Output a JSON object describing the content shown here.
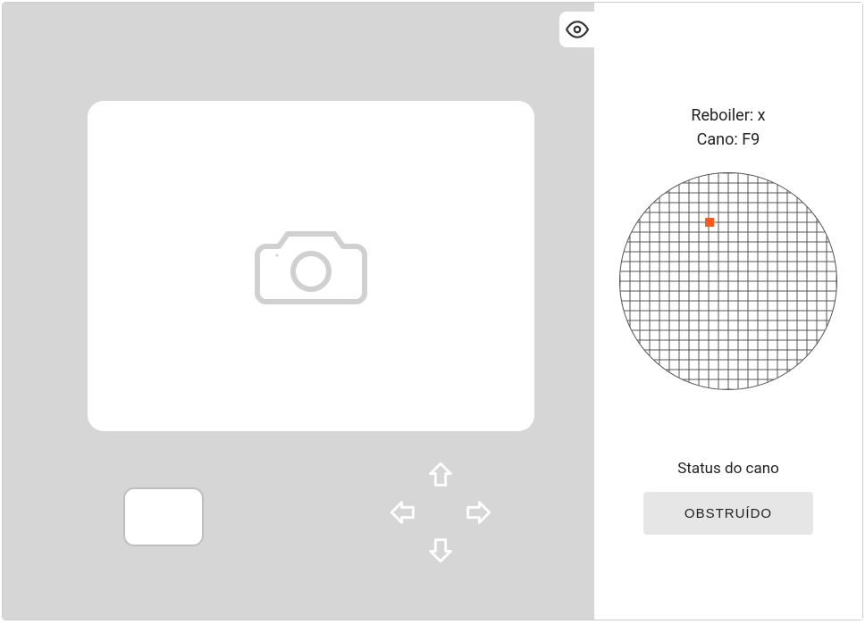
{
  "panel": {
    "reboiler_label": "Reboiler: ",
    "reboiler_value": "x",
    "cano_label": "Cano: ",
    "cano_value": "F9",
    "status_label": "Status do cano",
    "status_button": "OBSTRUÍDO"
  },
  "radar": {
    "grid_count": 22,
    "dot": {
      "col": 9,
      "row": 5
    }
  },
  "colors": {
    "panel_bg": "#d6d6d6",
    "accent": "#ff5722",
    "button_bg": "#e6e6e6"
  }
}
